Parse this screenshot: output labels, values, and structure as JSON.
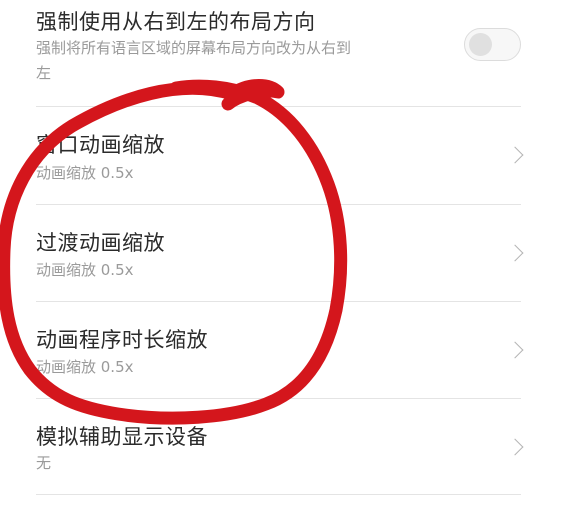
{
  "settings": {
    "rtl": {
      "title": "强制使用从右到左的布局方向",
      "subtitle_line1": "强制将所有语言区域的屏幕布局方向改为从右到",
      "subtitle_line2": "左",
      "toggle_on": false
    },
    "window_animation": {
      "title": "窗口动画缩放",
      "subtitle": "动画缩放 0.5x"
    },
    "transition_animation": {
      "title": "过渡动画缩放",
      "subtitle": "动画缩放 0.5x"
    },
    "animator_duration": {
      "title": "动画程序时长缩放",
      "subtitle": "动画缩放 0.5x"
    },
    "simulate_display": {
      "title": "模拟辅助显示设备",
      "subtitle": "无"
    }
  },
  "colors": {
    "annotation_stroke": "#d4161c",
    "title_text": "#2b2b2b",
    "subtitle_text": "#9a9a9a",
    "divider": "#e4e4e4"
  },
  "icons": {
    "chevron": "chevron-right-icon",
    "toggle": "toggle-switch"
  }
}
